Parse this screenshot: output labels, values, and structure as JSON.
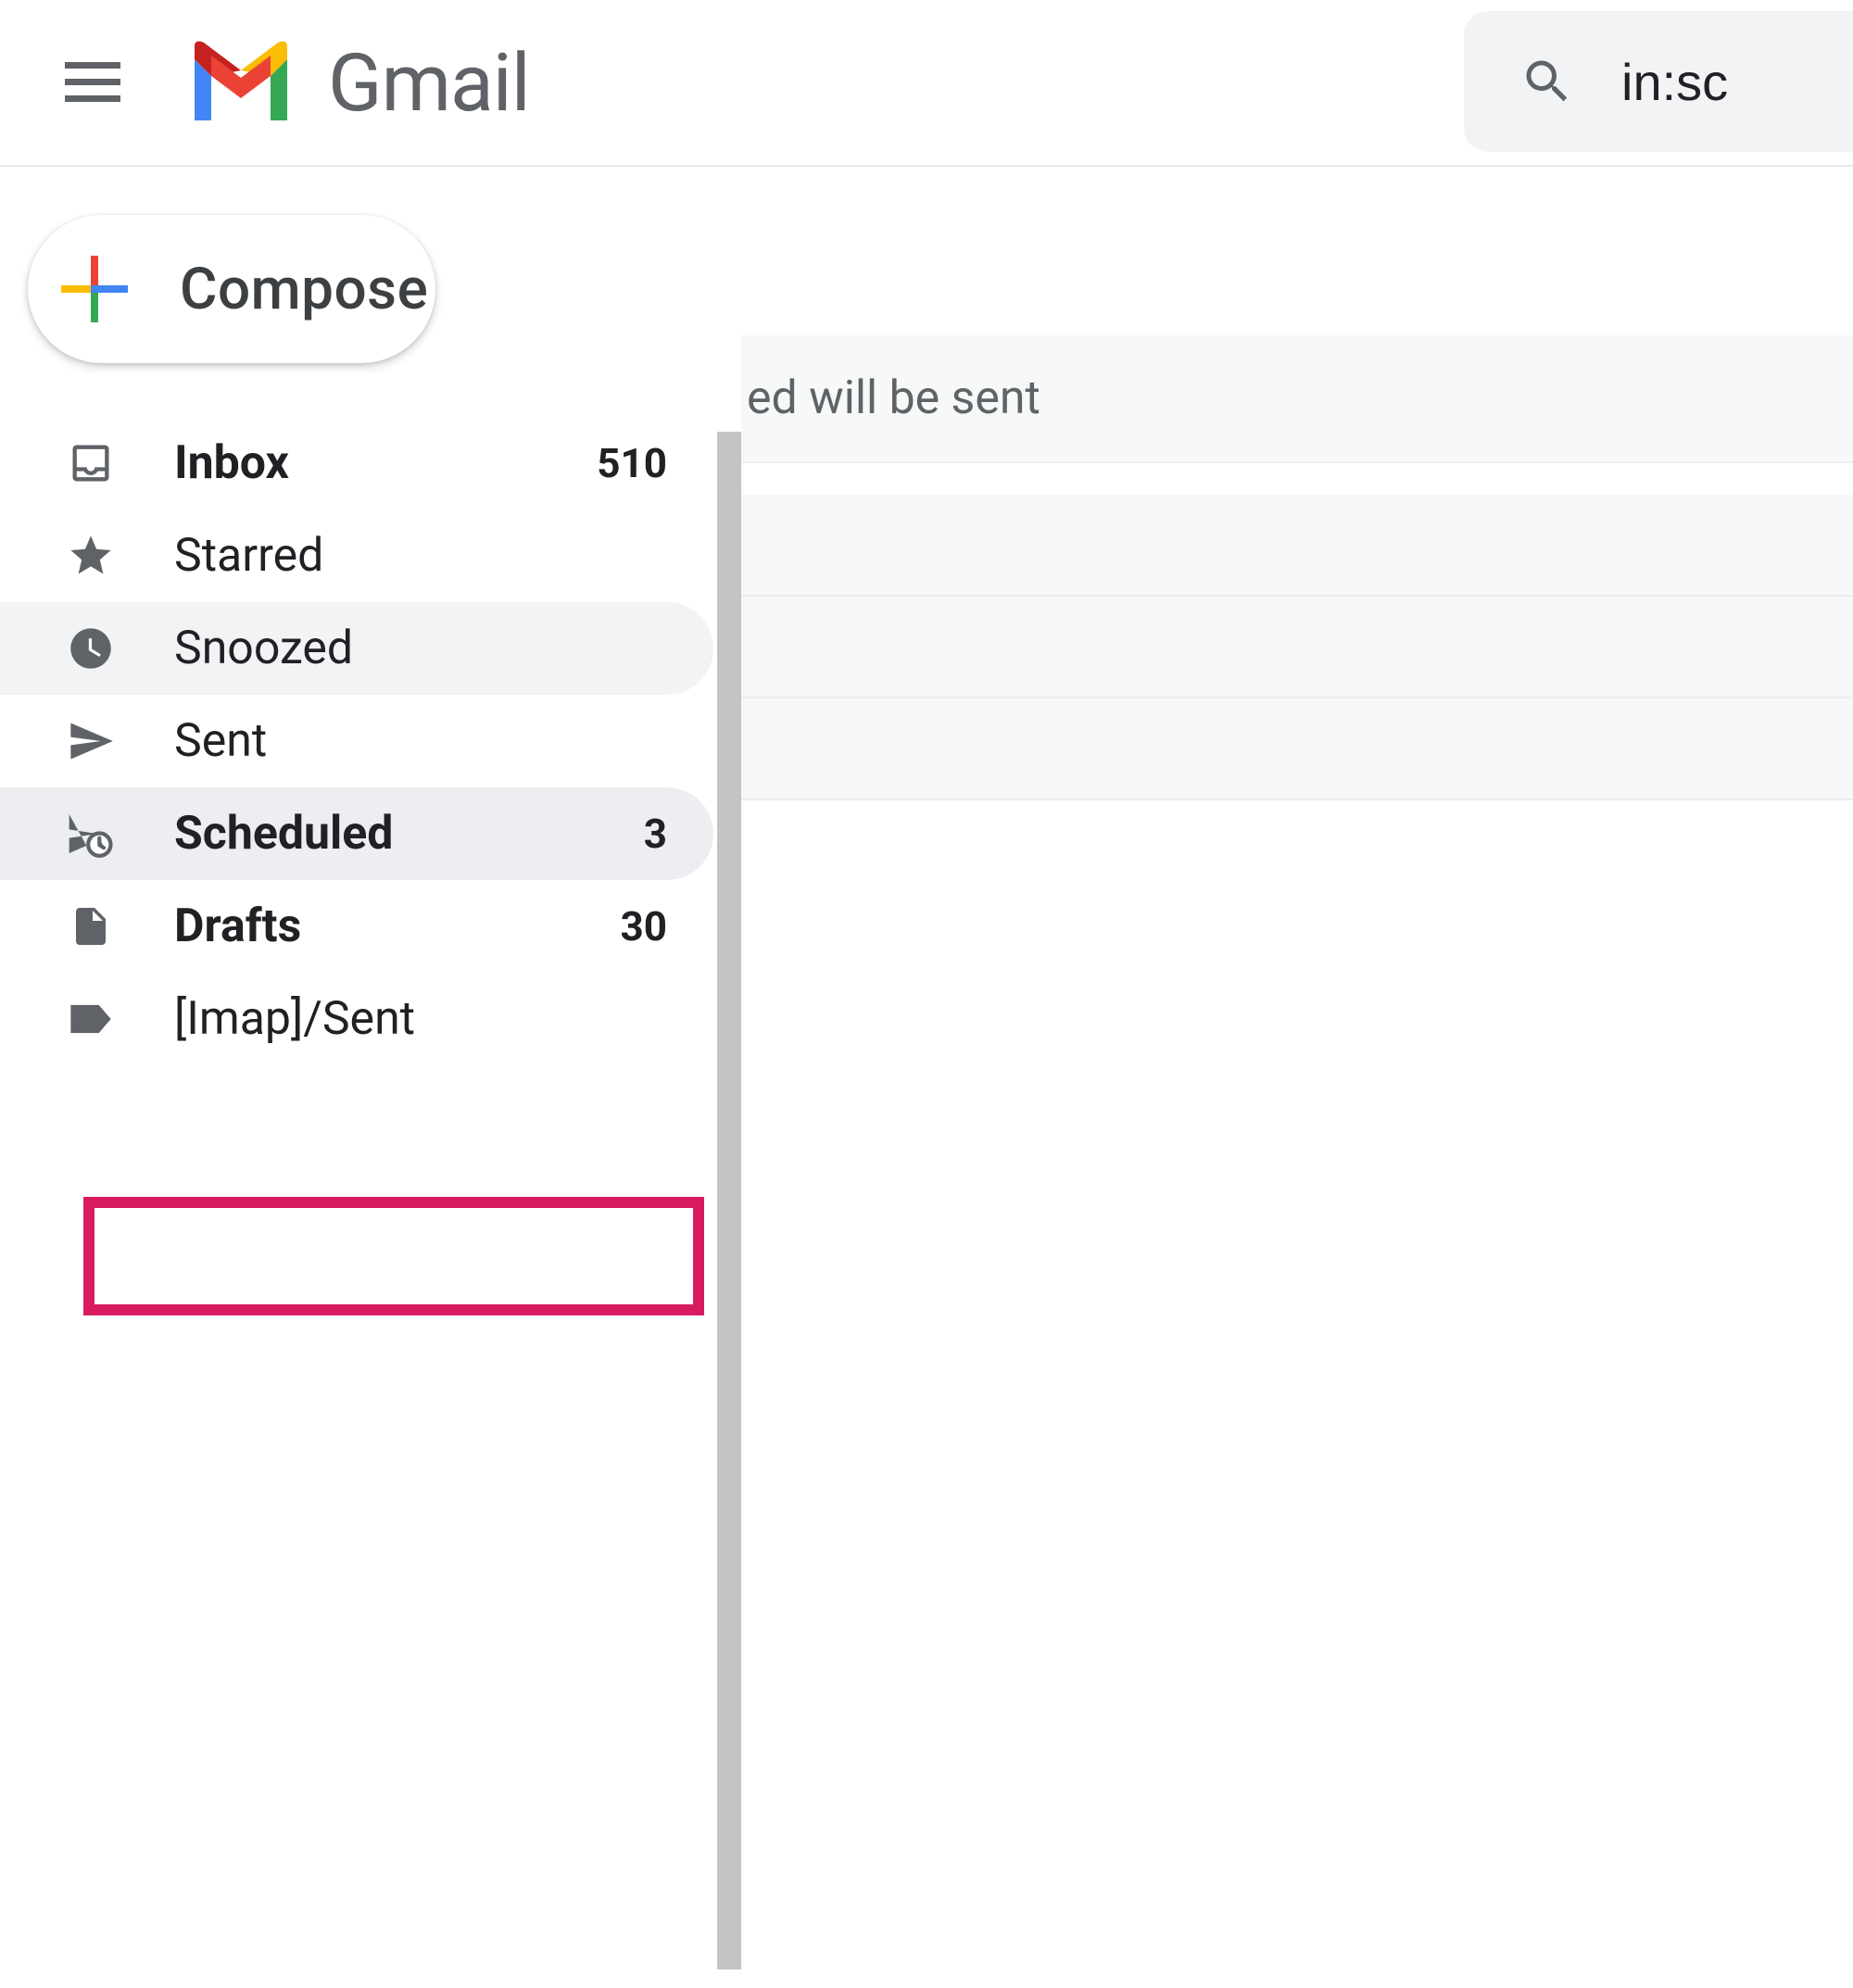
{
  "header": {
    "app_name": "Gmail"
  },
  "search": {
    "query": "in:sc"
  },
  "compose": {
    "label": "Compose"
  },
  "sidebar": {
    "items": [
      {
        "id": "inbox",
        "label": "Inbox",
        "count": "510",
        "bold": true,
        "icon": "inbox-icon"
      },
      {
        "id": "starred",
        "label": "Starred",
        "count": "",
        "bold": false,
        "icon": "star-icon"
      },
      {
        "id": "snoozed",
        "label": "Snoozed",
        "count": "",
        "bold": false,
        "icon": "clock-icon",
        "hovered": true
      },
      {
        "id": "sent",
        "label": "Sent",
        "count": "",
        "bold": false,
        "icon": "send-icon"
      },
      {
        "id": "scheduled",
        "label": "Scheduled",
        "count": "3",
        "bold": true,
        "icon": "schedule-send-icon",
        "selected": true,
        "highlighted": true
      },
      {
        "id": "drafts",
        "label": "Drafts",
        "count": "30",
        "bold": true,
        "icon": "file-icon"
      },
      {
        "id": "imap-sent",
        "label": "[Imap]/Sent",
        "count": "",
        "bold": false,
        "icon": "label-icon"
      }
    ]
  },
  "main": {
    "banner_text": "ed will be sent"
  }
}
